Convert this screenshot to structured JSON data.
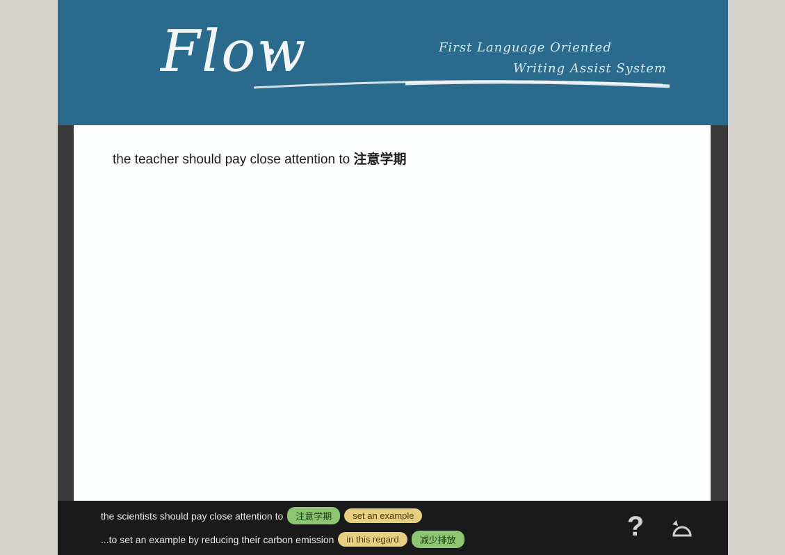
{
  "header": {
    "logo_text": "Flow",
    "tagline_line1": "First Language Oriented",
    "tagline_line2": "Writing Assist System"
  },
  "editor": {
    "text_prefix": "the teacher should pay close attention to ",
    "text_highlight": "注意学期"
  },
  "suggestions": [
    {
      "text": "the scientists should pay close attention to",
      "chips": [
        {
          "label": "注意学期",
          "color": "green"
        },
        {
          "label": "set an example",
          "color": "yellow"
        }
      ]
    },
    {
      "text": "...to set an example by reducing their carbon emission",
      "chips": [
        {
          "label": "in this regard",
          "color": "yellow"
        },
        {
          "label": "减少排放",
          "color": "green"
        }
      ]
    }
  ],
  "icons": {
    "help": "help-icon",
    "undo": "undo-icon"
  },
  "help_glyph": "?",
  "colors": {
    "header_bg": "#2a6a8c",
    "chip_green": "#8cc672",
    "chip_yellow": "#e6cf80"
  }
}
